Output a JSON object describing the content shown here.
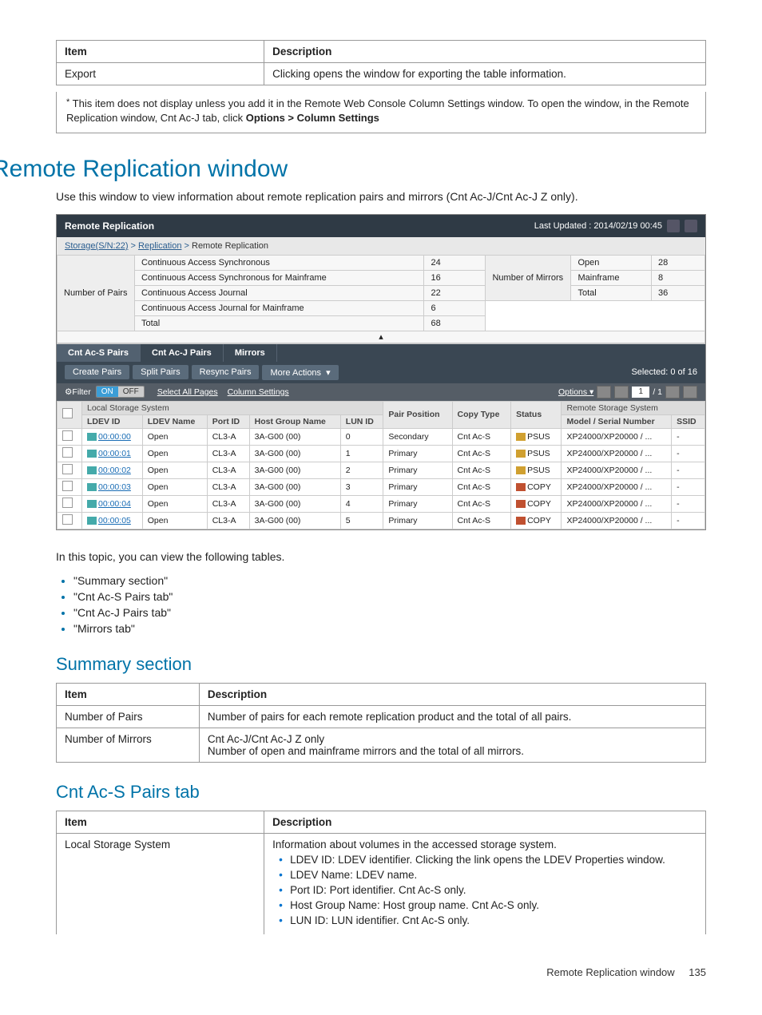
{
  "topTable": {
    "headers": [
      "Item",
      "Description"
    ],
    "row": [
      "Export",
      "Clicking opens the window for exporting the table information."
    ]
  },
  "footnote": {
    "star": "*",
    "text_a": "This item does not display unless you add it in the Remote Web Console Column Settings window. To open the window, in the Remote Replication window, Cnt Ac-J tab, click ",
    "bold": "Options > Column Settings"
  },
  "heading": "Remote Replication window",
  "intro": "Use this window to view information about remote replication pairs and mirrors (Cnt Ac-J/Cnt Ac-J Z only).",
  "screenshot": {
    "title": "Remote Replication",
    "updated": "Last Updated : 2014/02/19 00:45",
    "crumbs": [
      "Storage(S/N:22)",
      "Replication",
      "Remote Replication"
    ],
    "summary": {
      "pairsLabel": "Number of Pairs",
      "mirrorsLabel": "Number of Mirrors",
      "pairs": [
        {
          "l": "Continuous Access Synchronous",
          "v": "24"
        },
        {
          "l": "Continuous Access Synchronous for Mainframe",
          "v": "16"
        },
        {
          "l": "Continuous Access Journal",
          "v": "22"
        },
        {
          "l": "Continuous Access Journal for Mainframe",
          "v": "6"
        },
        {
          "l": "Total",
          "v": "68"
        }
      ],
      "mirrors": [
        {
          "l": "Open",
          "v": "28"
        },
        {
          "l": "Mainframe",
          "v": "8"
        },
        {
          "l": "Total",
          "v": "36"
        }
      ]
    },
    "tabs": [
      "Cnt Ac-S Pairs",
      "Cnt Ac-J Pairs",
      "Mirrors"
    ],
    "actions": [
      "Create Pairs",
      "Split Pairs",
      "Resync Pairs",
      "More Actions"
    ],
    "selected": "Selected:  0   of  16",
    "filter": {
      "label": "⚙Filter",
      "on": "ON",
      "off": "OFF",
      "selAll": "Select All Pages",
      "colSet": "Column Settings",
      "options": "Options ▾",
      "page": "1",
      "pages": "/ 1"
    },
    "gridHeaders": {
      "group1": "Local Storage System",
      "cols1": [
        "LDEV ID",
        "LDEV Name",
        "Port ID",
        "Host Group Name",
        "LUN ID"
      ],
      "col_pair": "Pair Position",
      "col_copy": "Copy Type",
      "col_status": "Status",
      "group2": "Remote Storage System",
      "cols2": [
        "Model / Serial Number",
        "SSID"
      ]
    },
    "rows": [
      {
        "ldev": "00:00:00",
        "name": "Open",
        "port": "CL3-A",
        "hg": "3A-G00 (00)",
        "lun": "0",
        "pair": "Secondary",
        "copy": "Cnt Ac-S",
        "status": "PSUS",
        "stype": "psus",
        "model": "XP24000/XP20000 / ...",
        "ssid": "-"
      },
      {
        "ldev": "00:00:01",
        "name": "Open",
        "port": "CL3-A",
        "hg": "3A-G00 (00)",
        "lun": "1",
        "pair": "Primary",
        "copy": "Cnt Ac-S",
        "status": "PSUS",
        "stype": "psus",
        "model": "XP24000/XP20000 / ...",
        "ssid": "-"
      },
      {
        "ldev": "00:00:02",
        "name": "Open",
        "port": "CL3-A",
        "hg": "3A-G00 (00)",
        "lun": "2",
        "pair": "Primary",
        "copy": "Cnt Ac-S",
        "status": "PSUS",
        "stype": "psus",
        "model": "XP24000/XP20000 / ...",
        "ssid": "-"
      },
      {
        "ldev": "00:00:03",
        "name": "Open",
        "port": "CL3-A",
        "hg": "3A-G00 (00)",
        "lun": "3",
        "pair": "Primary",
        "copy": "Cnt Ac-S",
        "status": "COPY",
        "stype": "copy",
        "model": "XP24000/XP20000 / ...",
        "ssid": "-"
      },
      {
        "ldev": "00:00:04",
        "name": "Open",
        "port": "CL3-A",
        "hg": "3A-G00 (00)",
        "lun": "4",
        "pair": "Primary",
        "copy": "Cnt Ac-S",
        "status": "COPY",
        "stype": "copy",
        "model": "XP24000/XP20000 / ...",
        "ssid": "-"
      },
      {
        "ldev": "00:00:05",
        "name": "Open",
        "port": "CL3-A",
        "hg": "3A-G00 (00)",
        "lun": "5",
        "pair": "Primary",
        "copy": "Cnt Ac-S",
        "status": "COPY",
        "stype": "copy",
        "model": "XP24000/XP20000 / ...",
        "ssid": "-"
      }
    ]
  },
  "afterImage": "In this topic, you can view the following tables.",
  "links": [
    "\"Summary section\"",
    "\"Cnt Ac-S Pairs tab\"",
    "\"Cnt Ac-J Pairs tab\"",
    "\"Mirrors tab\""
  ],
  "summarySection": {
    "title": "Summary section",
    "headers": [
      "Item",
      "Description"
    ],
    "rows": [
      [
        "Number of Pairs",
        "Number of pairs for each remote replication product and the total of all pairs."
      ],
      [
        "Number of Mirrors",
        "Cnt Ac-J/Cnt Ac-J Z only\nNumber of open and mainframe mirrors and the total of all mirrors."
      ]
    ]
  },
  "cntAcS": {
    "title": "Cnt Ac-S Pairs tab",
    "headers": [
      "Item",
      "Description"
    ],
    "row1_item": "Local Storage System",
    "row1_desc_intro": "Information about volumes in the accessed storage system.",
    "row1_bullets": [
      "LDEV ID: LDEV identifier. Clicking the link opens the LDEV Properties window.",
      "LDEV Name: LDEV name.",
      "Port ID: Port identifier. Cnt Ac-S only.",
      "Host Group Name: Host group name. Cnt Ac-S only.",
      "LUN ID: LUN identifier. Cnt Ac-S only."
    ]
  },
  "footer": {
    "title": "Remote Replication window",
    "page": "135"
  }
}
